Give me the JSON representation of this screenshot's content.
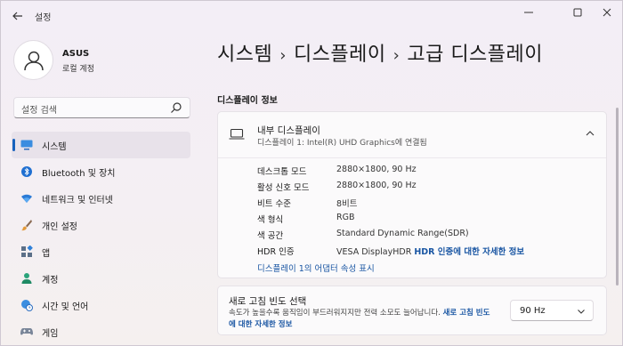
{
  "window": {
    "app_title": "설정",
    "controls": {
      "minimize": "—",
      "maximize": "☐",
      "close": "✕"
    }
  },
  "profile": {
    "name": "ASUS",
    "account": "로컬 계정"
  },
  "search": {
    "placeholder": "설정 검색"
  },
  "sidebar": {
    "items": [
      {
        "label": "시스템",
        "icon": "monitor-icon",
        "active": true
      },
      {
        "label": "Bluetooth 및 장치",
        "icon": "bluetooth-icon"
      },
      {
        "label": "네트워크 및 인터넷",
        "icon": "wifi-icon"
      },
      {
        "label": "개인 설정",
        "icon": "brush-icon"
      },
      {
        "label": "앱",
        "icon": "apps-icon"
      },
      {
        "label": "계정",
        "icon": "person-icon"
      },
      {
        "label": "시간 및 언어",
        "icon": "globe-clock-icon"
      },
      {
        "label": "게임",
        "icon": "gamepad-icon"
      }
    ]
  },
  "breadcrumb": [
    "시스템",
    "디스플레이",
    "고급 디스플레이"
  ],
  "section_title": "디스플레이 정보",
  "display_card": {
    "title": "내부 디스플레이",
    "subtitle": "디스플레이 1: Intel(R) UHD Graphics에 연결됨",
    "rows": [
      {
        "label": "데스크톱 모드",
        "value": "2880×1800, 90 Hz"
      },
      {
        "label": "활성 신호 모드",
        "value": "2880×1800, 90 Hz"
      },
      {
        "label": "비트 수준",
        "value": "8비트"
      },
      {
        "label": "색 형식",
        "value": "RGB"
      },
      {
        "label": "색 공간",
        "value": "Standard Dynamic Range(SDR)"
      },
      {
        "label": "HDR 인증",
        "value": "VESA DisplayHDR",
        "link": "HDR 인증에 대한 자세한 정보"
      }
    ],
    "adapter_link": "디스플레이 1의 어댑터 속성 표시"
  },
  "refresh_card": {
    "title": "새로 고침 빈도 선택",
    "desc": "속도가 높을수록 움직임이 부드러워지지만 전력 소모도 늘어납니다.",
    "desc_link": "새로 고침 빈도에 대한 자세한 정보",
    "selected": "90 Hz"
  },
  "colors": {
    "accent": "#1862bd",
    "link": "#1a56a3"
  }
}
